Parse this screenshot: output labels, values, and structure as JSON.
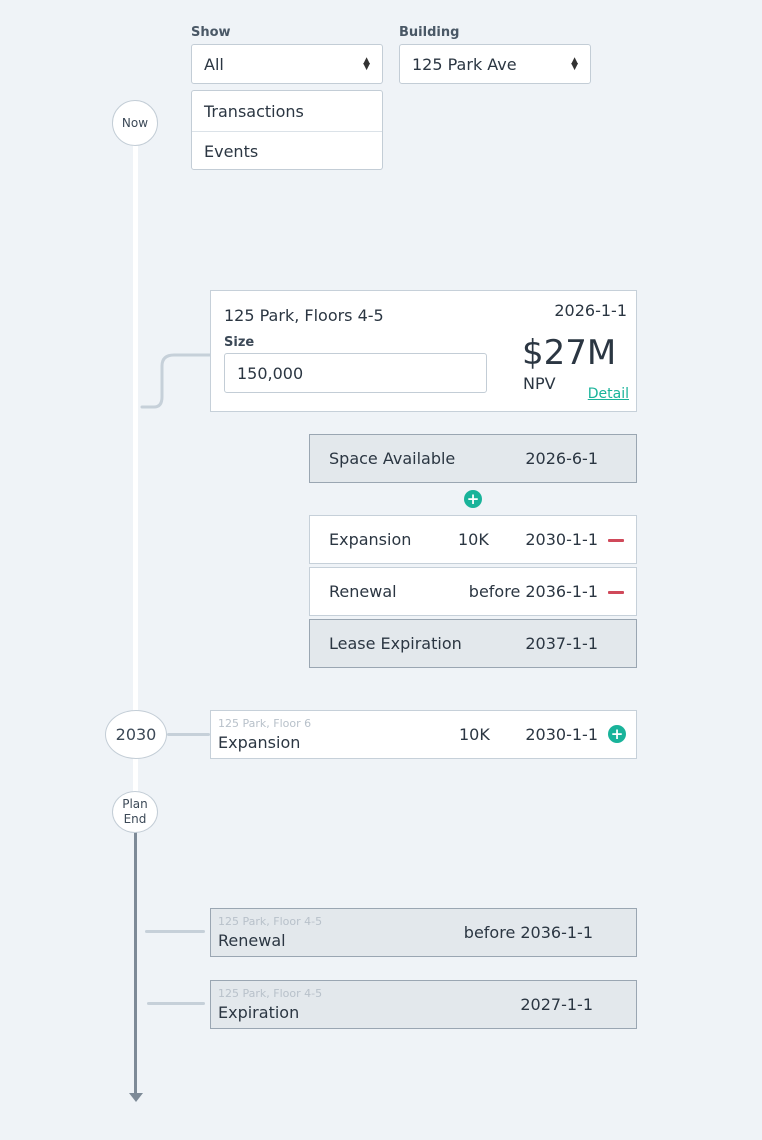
{
  "filters": {
    "show_label": "Show",
    "show_value": "All",
    "show_options": [
      "Transactions",
      "Events"
    ],
    "building_label": "Building",
    "building_value": "125 Park Ave"
  },
  "timeline": {
    "now_label": "Now",
    "year_marker": "2030",
    "plan_end_line1": "Plan",
    "plan_end_line2": "End"
  },
  "transaction_card": {
    "title": "125 Park, Floors 4-5",
    "date": "2026-1-1",
    "size_label": "Size",
    "size_value": "150,000",
    "npv_value": "$27M",
    "npv_label": "NPV",
    "detail_link": "Detail"
  },
  "events": [
    {
      "name": "Space Available",
      "size": "",
      "date": "2026-6-1",
      "style": "gray"
    },
    {
      "name": "Expansion",
      "size": "10K",
      "date": "2030-1-1",
      "style": "white",
      "action": "remove"
    },
    {
      "name": "Renewal",
      "size": "",
      "date": "before 2036-1-1",
      "style": "white",
      "action": "remove"
    },
    {
      "name": "Lease Expiration",
      "size": "",
      "date": "2037-1-1",
      "style": "gray"
    }
  ],
  "timeline_entries": [
    {
      "building": "125 Park, Floor 6",
      "name": "Expansion",
      "size": "10K",
      "date": "2030-1-1"
    },
    {
      "building": "125 Park, Floor 4-5",
      "name": "Renewal",
      "size": "",
      "date": "before 2036-1-1"
    },
    {
      "building": "125 Park, Floor 4-5",
      "name": "Expiration",
      "size": "",
      "date": "2027-1-1"
    }
  ],
  "icons": {
    "plus": "plus-circle-icon",
    "minus": "minus-icon"
  },
  "colors": {
    "accent": "#19b39a",
    "danger": "#d0495a",
    "timeline_after_plan": "#7d8a97"
  }
}
